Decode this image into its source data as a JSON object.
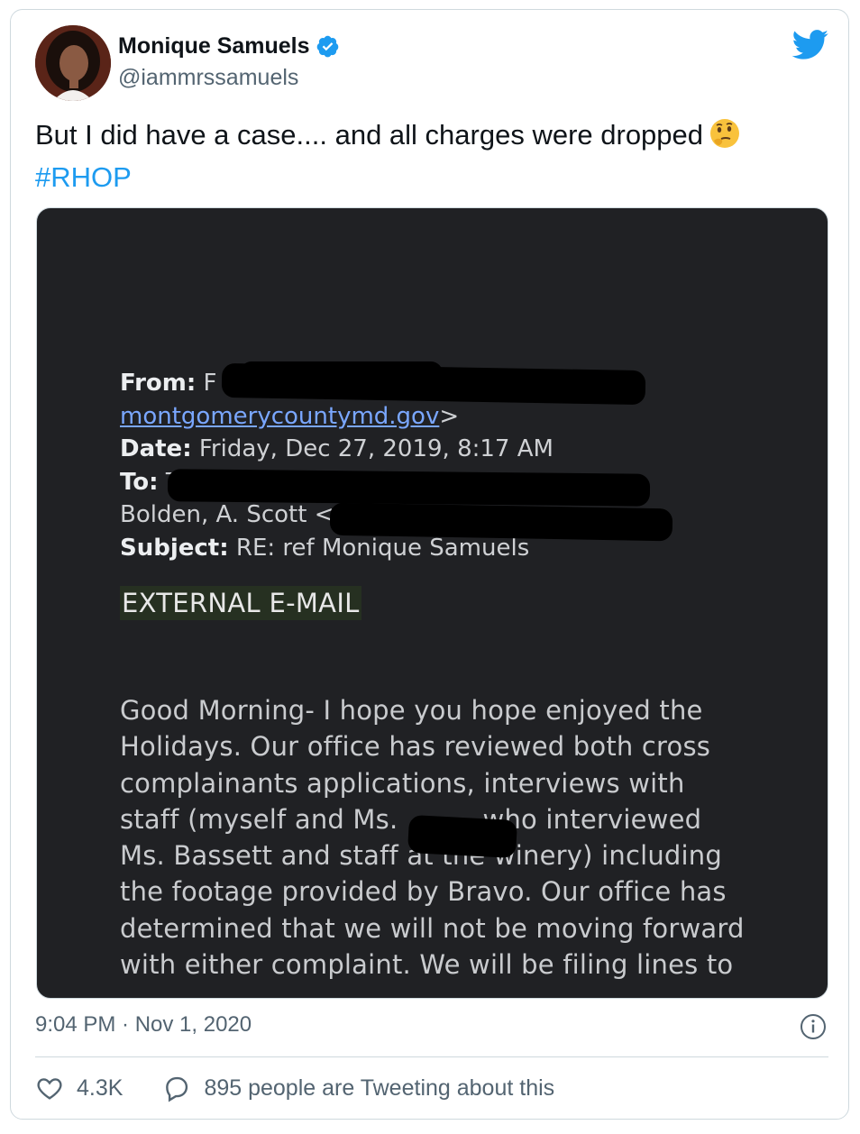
{
  "author": {
    "display_name": "Monique Samuels",
    "handle": "@iammrssamuels"
  },
  "tweet": {
    "text": "But I did have a case.... and all charges were dropped",
    "emoji": "thinking-face-emoji",
    "hashtag": "#RHOP"
  },
  "email": {
    "from_label": "From:",
    "from_value": "F",
    "from_domain": "montgomerycountymd.gov",
    "from_domain_suffix": ">",
    "date_label": "Date:",
    "date_value": "Friday, Dec 27, 2019, 8:17 AM",
    "to_label": "To:",
    "to_value": "T",
    "to_suffix": ",",
    "cc_value": "Bolden, A. Scott <",
    "subject_label": "Subject:",
    "subject_value": "RE: ref Monique Samuels",
    "external_banner": "EXTERNAL E-MAIL",
    "body_lines": [
      "Good Morning- I hope you hope enjoyed the",
      "Holidays. Our office has reviewed both cross",
      "complainants applications, interviews with",
      "staff (myself and Ms.          who interviewed",
      "Ms. Bassett and staff at the winery) including",
      "the footage provided by Bravo. Our office has",
      "determined that we will not be moving forward",
      "with either complaint. We will be filing lines to"
    ]
  },
  "meta": {
    "timestamp": "9:04 PM · Nov 1, 2020"
  },
  "actions": {
    "likes": "4.3K",
    "conversation": "895 people are Tweeting about this"
  },
  "colors": {
    "accent": "#1d9bf0",
    "text": "#0f1419",
    "muted": "#536471",
    "media_bg": "#202124"
  }
}
